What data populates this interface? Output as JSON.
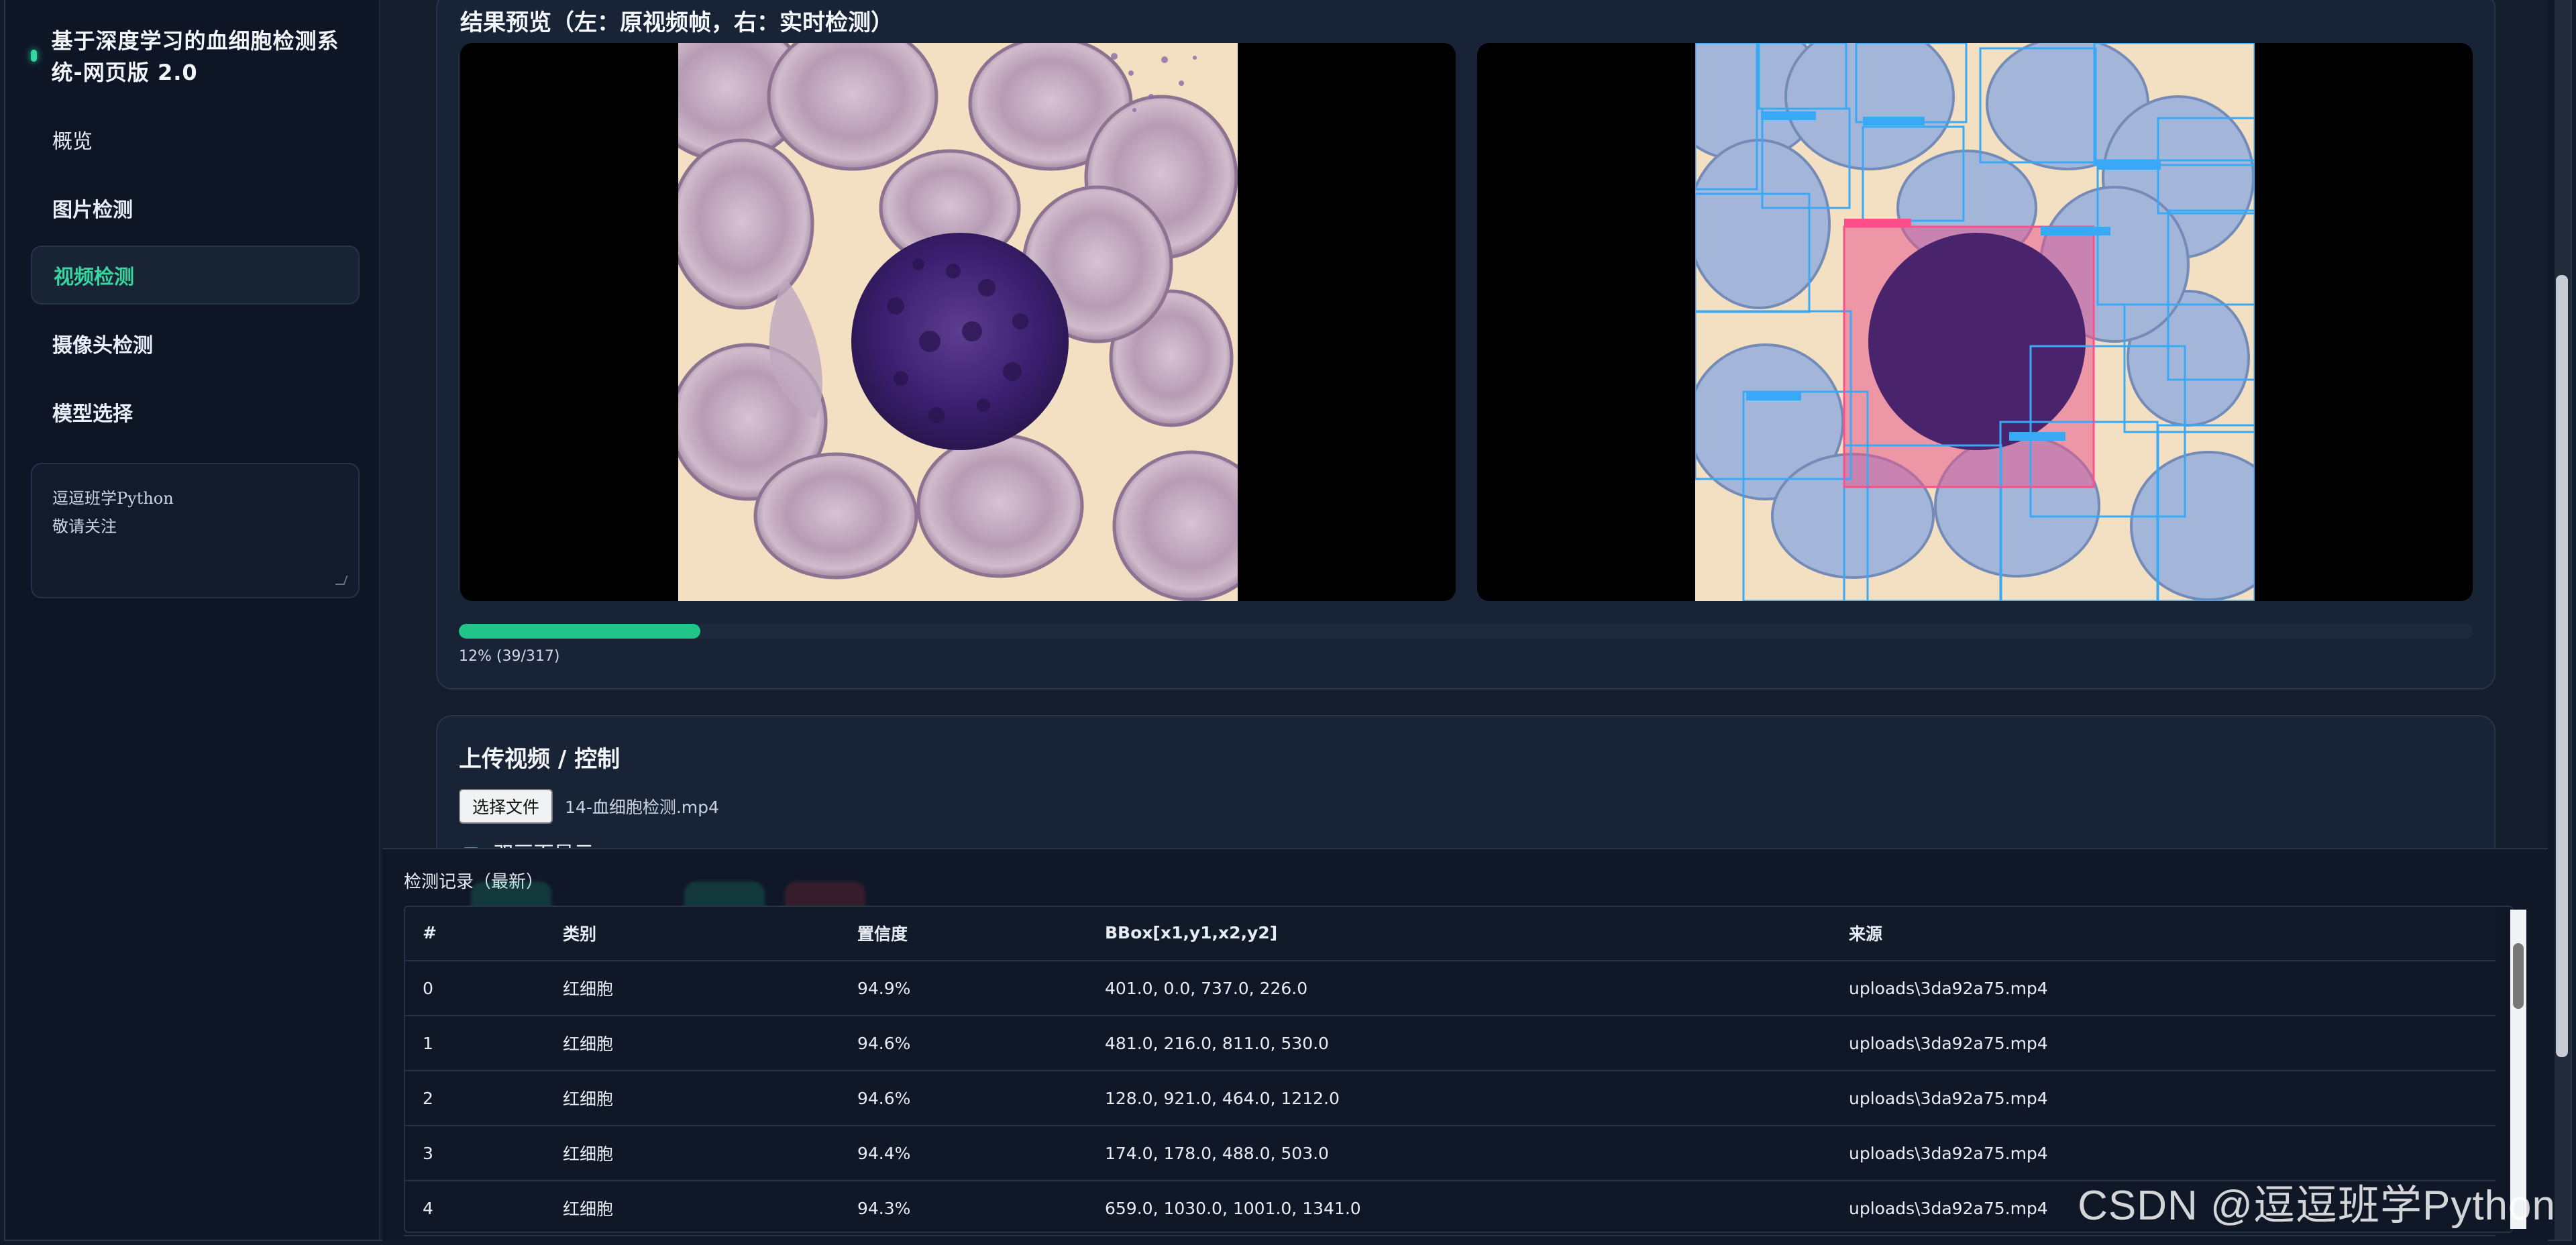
{
  "sidebar": {
    "title": "基于深度学习的血细胞检测系统-网页版 2.0",
    "items": [
      {
        "label": "概览"
      },
      {
        "label": "图片检测"
      },
      {
        "label": "视频检测"
      },
      {
        "label": "摄像头检测"
      },
      {
        "label": "模型选择"
      }
    ],
    "note": "逗逗班学Python\n敬请关注"
  },
  "preview": {
    "title": "结果预览（左：原视频帧，右：实时检测）",
    "progress": {
      "percent": 12,
      "text": "12% (39/317)"
    }
  },
  "upload": {
    "title": "上传视频 / 控制",
    "choose_file": "选择文件",
    "file_name": "14-血细胞检测.mp4",
    "checkbox_label": "双画面显示"
  },
  "log": {
    "title": "检测记录（最新）",
    "headers": [
      "#",
      "类别",
      "置信度",
      "BBox[x1,y1,x2,y2]",
      "来源"
    ],
    "rows": [
      [
        "0",
        "红细胞",
        "94.9%",
        "401.0, 0.0, 737.0, 226.0",
        "uploads\\3da92a75.mp4"
      ],
      [
        "1",
        "红细胞",
        "94.6%",
        "481.0, 216.0, 811.0, 530.0",
        "uploads\\3da92a75.mp4"
      ],
      [
        "2",
        "红细胞",
        "94.6%",
        "128.0, 921.0, 464.0, 1212.0",
        "uploads\\3da92a75.mp4"
      ],
      [
        "3",
        "红细胞",
        "94.4%",
        "174.0, 178.0, 488.0, 503.0",
        "uploads\\3da92a75.mp4"
      ],
      [
        "4",
        "红细胞",
        "94.3%",
        "659.0, 1030.0, 1001.0, 1341.0",
        "uploads\\3da92a75.mp4"
      ]
    ]
  },
  "watermark": "CSDN @逗逗班学Python",
  "colors": {
    "accent": "#21c589",
    "detection_blue": "#3aa9f5",
    "detection_pink": "#ff4f8b"
  }
}
